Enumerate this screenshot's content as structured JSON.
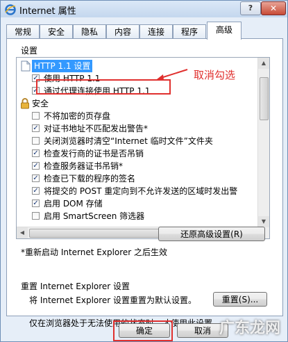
{
  "window": {
    "title": "Internet 属性",
    "help_label": "?",
    "close_label": "✕"
  },
  "tabs": [
    {
      "label": "常规"
    },
    {
      "label": "安全"
    },
    {
      "label": "隐私"
    },
    {
      "label": "内容"
    },
    {
      "label": "连接"
    },
    {
      "label": "程序"
    },
    {
      "label": "高级",
      "active": true
    }
  ],
  "settings": {
    "group_label": "设置",
    "rows": [
      {
        "type": "category",
        "icon": "http-category-icon",
        "label": "HTTP 1.1 设置",
        "selected": true
      },
      {
        "type": "checkbox",
        "label": "使用 HTTP 1.1",
        "checked": true
      },
      {
        "type": "checkbox",
        "label": "通过代理连接使用 HTTP 1.1",
        "checked": true
      },
      {
        "type": "category",
        "icon": "lock-icon",
        "label": "安全"
      },
      {
        "type": "checkbox",
        "label": "不将加密的页存盘",
        "checked": false
      },
      {
        "type": "checkbox",
        "label": "对证书地址不匹配发出警告*",
        "checked": true
      },
      {
        "type": "checkbox",
        "label": "关闭浏览器时清空“Internet 临时文件”文件夹",
        "checked": false
      },
      {
        "type": "checkbox",
        "label": "检查发行商的证书是否吊销",
        "checked": true
      },
      {
        "type": "checkbox",
        "label": "检查服务器证书吊销*",
        "checked": true
      },
      {
        "type": "checkbox",
        "label": "检查已下载的程序的签名",
        "checked": true
      },
      {
        "type": "checkbox",
        "label": "将提交的 POST 重定向到不允许发送的区域时发出警",
        "checked": true
      },
      {
        "type": "checkbox",
        "label": "启用 DOM 存储",
        "checked": true
      },
      {
        "type": "checkbox",
        "label": "启用 SmartScreen 筛选器",
        "checked": false
      }
    ]
  },
  "restart_note": "*重新启动 Internet Explorer 之后生效",
  "restore_button": "还原高级设置(R)",
  "reset": {
    "heading": "重置 Internet Explorer 设置",
    "description": "将 Internet Explorer 设置重置为默认设置。",
    "button": "重置(S)...",
    "note": "仅在浏览器处于无法使用的状态时，才使用此设置。"
  },
  "footer": {
    "ok": "确定",
    "cancel": "取消"
  },
  "annotation": {
    "text": "取消勾选",
    "color": "#e0302e"
  },
  "watermark": "广东龙网"
}
